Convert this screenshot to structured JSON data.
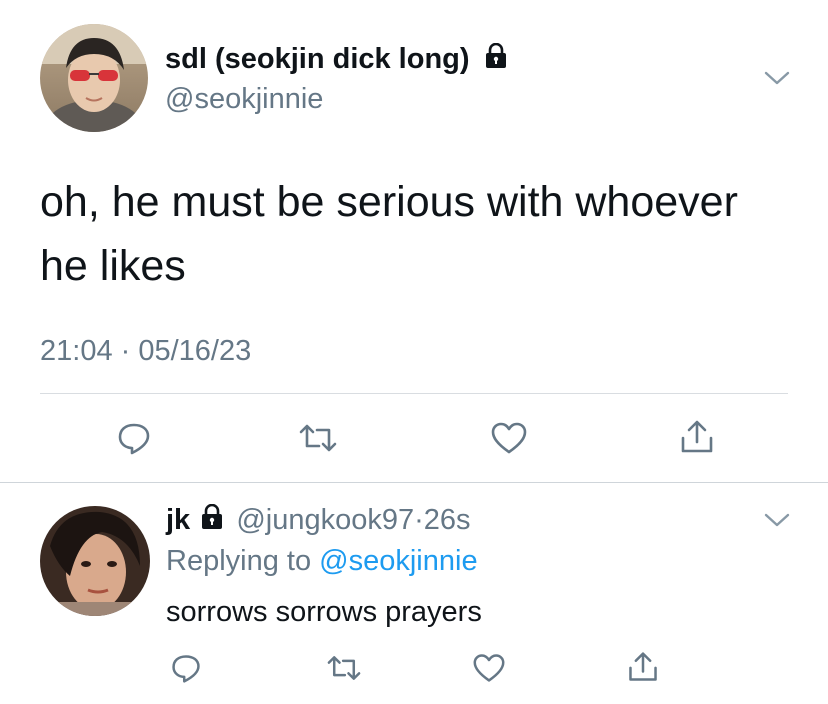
{
  "main_tweet": {
    "display_name": "sdl (seokjin dick long)",
    "handle": "@seokjinnie",
    "text_line1": "oh, he must be serious with whoever",
    "text_line2": "he likes",
    "timestamp": "21:04 · 05/16/23",
    "locked": true
  },
  "reply_tweet": {
    "display_name": "jk",
    "handle": "@jungkook97",
    "separator": "·",
    "age": "26s",
    "replying_prefix": "Replying to",
    "replying_handle": "@seokjinnie",
    "text": "sorrows sorrows prayers",
    "locked": true
  },
  "actions": [
    "reply-icon",
    "retweet-icon",
    "like-icon",
    "share-icon"
  ],
  "colors": {
    "text": "#0f1419",
    "muted": "#657786",
    "link": "#1d9bf0",
    "divider": "#d9dde1"
  }
}
